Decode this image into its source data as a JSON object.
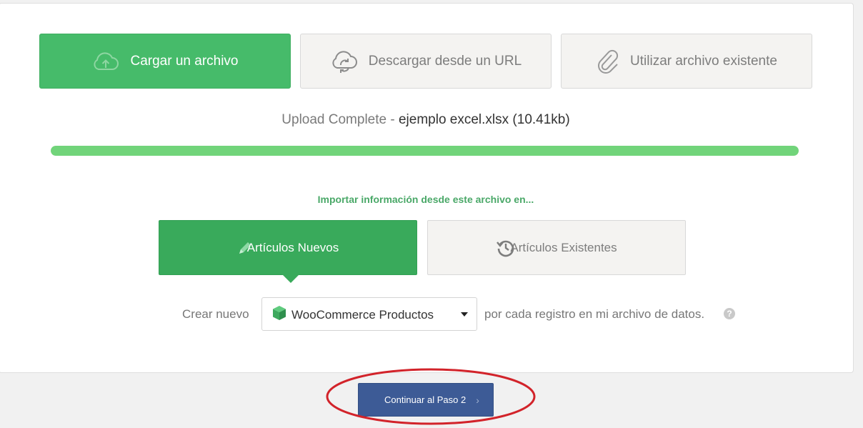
{
  "source_tabs": [
    {
      "label": "Cargar un archivo",
      "icon": "cloud-upload-icon",
      "active": true
    },
    {
      "label": "Descargar desde un URL",
      "icon": "cloud-sync-icon",
      "active": false
    },
    {
      "label": "Utilizar archivo existente",
      "icon": "paperclip-icon",
      "active": false
    }
  ],
  "upload_status": {
    "label": "Upload Complete",
    "separator": " - ",
    "filename": "ejemplo excel.xlsx (10.41kb)",
    "progress": 1.0
  },
  "import": {
    "label": "Importar información desde este archivo en...",
    "choices": [
      {
        "label": "Artículos Nuevos",
        "icon": "pencil-icon",
        "active": true
      },
      {
        "label": "Artículos Existentes",
        "icon": "history-icon",
        "active": false
      }
    ]
  },
  "create_row": {
    "prefix": "Crear nuevo",
    "selected": "WooCommerce Productos",
    "suffix": "por cada registro en mi archivo de datos.",
    "help": "?"
  },
  "continue_button": {
    "label": "Continuar al Paso 2",
    "chevron": "›"
  },
  "colors": {
    "accent_green": "#46bb6a",
    "dark_green": "#39aa5b",
    "progress_green": "#71d47a",
    "continue_blue": "#3d5b96",
    "highlight_red": "#d2232a"
  }
}
